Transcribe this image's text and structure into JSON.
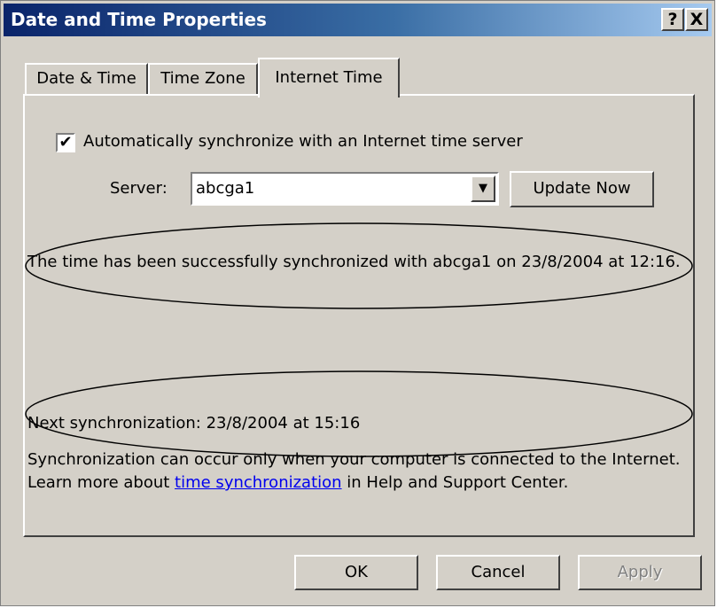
{
  "window": {
    "title": "Date and Time Properties",
    "help_label": "?",
    "close_label": "X"
  },
  "tabs": [
    {
      "label": "Date & Time",
      "active": false
    },
    {
      "label": "Time Zone",
      "active": false
    },
    {
      "label": "Internet Time",
      "active": true
    }
  ],
  "internet_time": {
    "auto_sync_checked": true,
    "checkbox_mark": "✔",
    "auto_sync_label": "Automatically synchronize with an Internet time server",
    "server_label": "Server:",
    "server_value": "abcga1",
    "dropdown_arrow": "▼",
    "update_now_label": "Update Now",
    "sync_status": "The time has been successfully synchronized with abcga1 on 23/8/2004 at 12:16.",
    "next_sync": "Next synchronization: 23/8/2004 at 15:16",
    "note_before_link": "Synchronization can occur only when your computer is connected to the Internet.  Learn more about ",
    "note_link": "time synchronization",
    "note_after_link": " in Help and Support Center."
  },
  "buttons": {
    "ok": "OK",
    "cancel": "Cancel",
    "apply": "Apply"
  }
}
